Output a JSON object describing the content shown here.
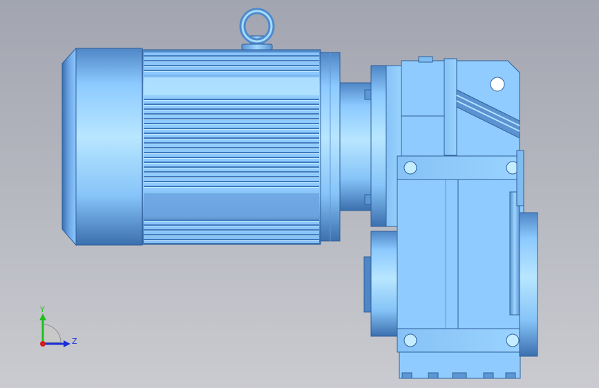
{
  "viewport": {
    "background_top": "#a3a6b1",
    "background_bottom": "#c9cbd0",
    "model_color": "#8ccaff",
    "model_highlight": "#b6e4ff",
    "model_shadow": "#3f76b8",
    "model_edge": "#2e5f9a"
  },
  "triad": {
    "y_label": "Y",
    "z_label": "Z",
    "y_color": "#1fbf1f",
    "z_color": "#1a2fd6",
    "x_color": "#d21d1d"
  }
}
